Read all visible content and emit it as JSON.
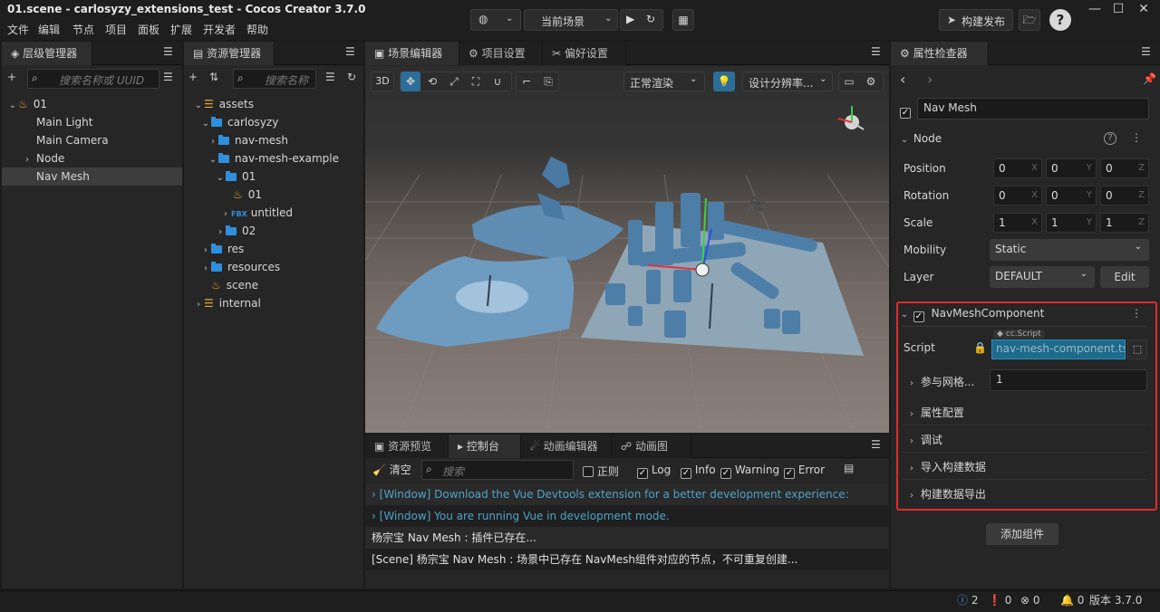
{
  "app": {
    "title": "01.scene - carlosyzy_extensions_test - Cocos Creator 3.7.0"
  },
  "menu": [
    "文件",
    "编辑",
    "节点",
    "项目",
    "面板",
    "扩展",
    "开发者",
    "帮助"
  ],
  "toolbar": {
    "scene_select": "当前场景",
    "build_publish": "构建发布"
  },
  "hierarchy": {
    "tab": "层级管理器",
    "search_placeholder": "搜索名称或 UUID",
    "items": [
      {
        "label": "01",
        "level": 0,
        "icon": "fire-icon",
        "arrow": "v"
      },
      {
        "label": "Main Light",
        "level": 1
      },
      {
        "label": "Main Camera",
        "level": 1
      },
      {
        "label": "Node",
        "level": 1,
        "arrow": ">"
      },
      {
        "label": "Nav Mesh",
        "level": 1,
        "selected": true
      }
    ]
  },
  "assets": {
    "tab": "资源管理器",
    "search_placeholder": "搜索名称",
    "items": [
      {
        "label": "assets",
        "level": 0,
        "arrow": "v",
        "icon": "db-icon"
      },
      {
        "label": "carlosyzy",
        "level": 1,
        "arrow": "v",
        "icon": "folder"
      },
      {
        "label": "nav-mesh",
        "level": 2,
        "arrow": ">",
        "icon": "folder"
      },
      {
        "label": "nav-mesh-example",
        "level": 2,
        "arrow": "v",
        "icon": "folder"
      },
      {
        "label": "01",
        "level": 3,
        "arrow": "v",
        "icon": "folder"
      },
      {
        "label": "01",
        "level": 4,
        "icon": "fire"
      },
      {
        "label": "untitled",
        "level": 4,
        "arrow": ">",
        "icon": "fbx",
        "icon_text": "FBX"
      },
      {
        "label": "02",
        "level": 3,
        "arrow": ">",
        "icon": "folder"
      },
      {
        "label": "res",
        "level": 1,
        "arrow": ">",
        "icon": "folder"
      },
      {
        "label": "resources",
        "level": 1,
        "arrow": ">",
        "icon": "folder"
      },
      {
        "label": "scene",
        "level": 1,
        "icon": "fire"
      },
      {
        "label": "internal",
        "level": 0,
        "arrow": ">",
        "icon": "db-icon"
      }
    ]
  },
  "scene": {
    "tabs": [
      "场景编辑器",
      "项目设置",
      "偏好设置"
    ],
    "btn_3d": "3D",
    "render_mode": "正常渲染",
    "resolution": "设计分辨率..."
  },
  "console": {
    "tabs": [
      "资源预览",
      "控制台",
      "动画编辑器",
      "动画图"
    ],
    "clear": "清空",
    "search_placeholder": "搜索",
    "filters": {
      "regex": "正则",
      "log": "Log",
      "info": "Info",
      "warning": "Warning",
      "error": "Error"
    },
    "lines": [
      {
        "text": "[Window] Download the Vue Devtools extension for a better development experience:",
        "kind": "info"
      },
      {
        "text": "[Window] You are running Vue in development mode.",
        "kind": "info"
      },
      {
        "text": "杨宗宝 Nav Mesh : 插件已存在...",
        "kind": "log"
      },
      {
        "text": "[Scene] 杨宗宝 Nav Mesh : 场景中已存在 NavMesh组件对应的节点，不可重复创建...",
        "kind": "log"
      }
    ]
  },
  "inspector": {
    "tab": "属性检查器",
    "node_name": "Nav Mesh",
    "node_section": "Node",
    "position": {
      "label": "Position",
      "x": "0",
      "y": "0",
      "z": "0"
    },
    "rotation": {
      "label": "Rotation",
      "x": "0",
      "y": "0",
      "z": "0"
    },
    "scale": {
      "label": "Scale",
      "x": "1",
      "y": "1",
      "z": "1"
    },
    "mobility": {
      "label": "Mobility",
      "value": "Static"
    },
    "layer": {
      "label": "Layer",
      "value": "DEFAULT",
      "edit": "Edit"
    },
    "component": {
      "name": "NavMeshComponent",
      "script_label": "Script",
      "script_tag": "cc.Script",
      "script_value": "nav-mesh-component.ts",
      "param_label": "参与网格...",
      "param_value": "1",
      "sections": [
        "属性配置",
        "调试",
        "导入构建数据",
        "构建数据导出"
      ]
    },
    "add_component": "添加组件"
  },
  "statusbar": {
    "info": "2",
    "warn": "0",
    "error": "0",
    "notify": "0",
    "version": "版本 3.7.0"
  },
  "colors": {
    "accent": "#2f8fdc",
    "highlight": "#e02b2b",
    "script_field": "#1c6a8c"
  }
}
